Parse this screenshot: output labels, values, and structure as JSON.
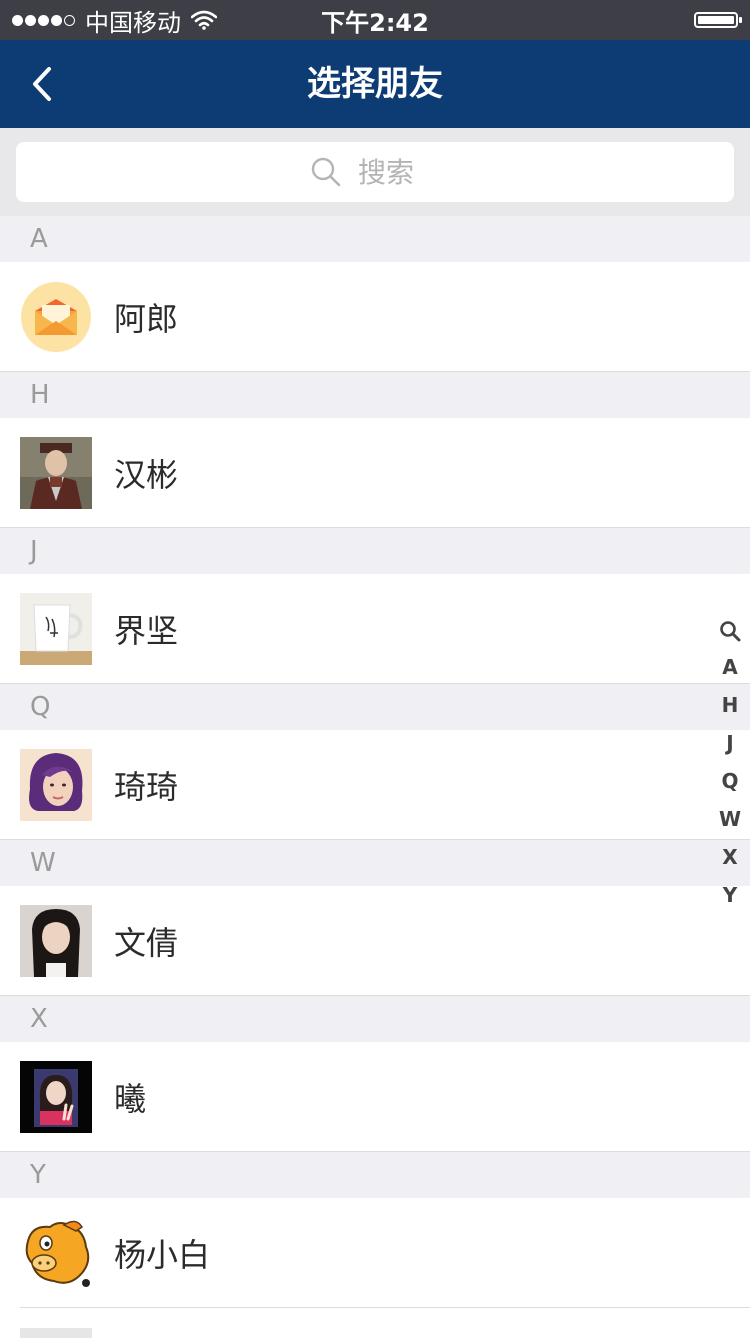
{
  "status_bar": {
    "carrier": "中国移动",
    "time": "下午2:42",
    "signal_dots_filled": 4,
    "signal_dots_total": 5,
    "battery_level": 1.0
  },
  "nav": {
    "title": "选择朋友",
    "back_icon": "chevron-left-icon",
    "background": "#0d3c74"
  },
  "search": {
    "placeholder": "搜索",
    "value": "",
    "icon": "search-icon"
  },
  "sections": [
    {
      "letter": "A",
      "contacts": [
        {
          "name": "阿郎",
          "avatar": "envelope-avatar"
        }
      ]
    },
    {
      "letter": "H",
      "contacts": [
        {
          "name": "汉彬",
          "avatar": "painting-portrait-avatar"
        }
      ]
    },
    {
      "letter": "J",
      "contacts": [
        {
          "name": "界坚",
          "avatar": "mug-avatar"
        }
      ]
    },
    {
      "letter": "Q",
      "contacts": [
        {
          "name": "琦琦",
          "avatar": "woman-purple-hair-avatar"
        }
      ]
    },
    {
      "letter": "W",
      "contacts": [
        {
          "name": "文倩",
          "avatar": "girl-long-hair-avatar"
        }
      ]
    },
    {
      "letter": "X",
      "contacts": [
        {
          "name": "曦",
          "avatar": "girl-peace-sign-avatar"
        }
      ]
    },
    {
      "letter": "Y",
      "contacts": [
        {
          "name": "杨小白",
          "avatar": "cartoon-horse-avatar"
        }
      ]
    }
  ],
  "index_bar": [
    "search-index-icon",
    "A",
    "H",
    "J",
    "Q",
    "W",
    "X",
    "Y"
  ]
}
